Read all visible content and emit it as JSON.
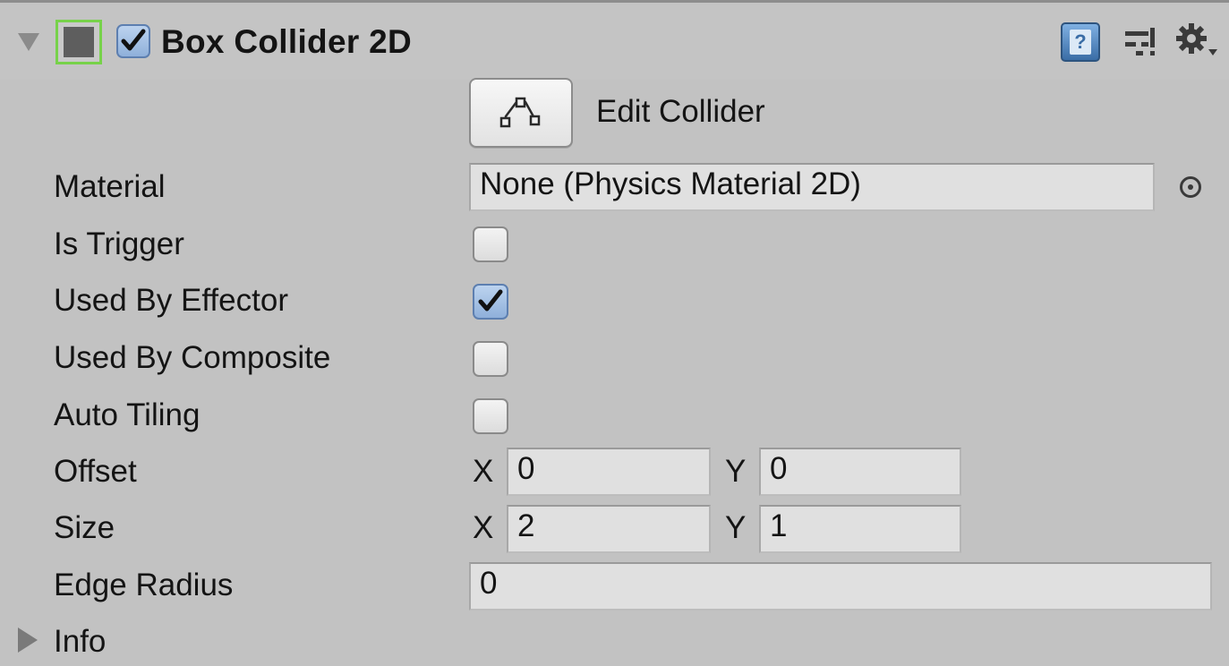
{
  "component": {
    "title": "Box Collider 2D",
    "enabled": true
  },
  "edit_collider": {
    "label": "Edit Collider"
  },
  "fields": {
    "material": {
      "label": "Material",
      "value": "None (Physics Material 2D)"
    },
    "is_trigger": {
      "label": "Is Trigger",
      "checked": false
    },
    "used_by_effector": {
      "label": "Used By Effector",
      "checked": true
    },
    "used_by_composite": {
      "label": "Used By Composite",
      "checked": false
    },
    "auto_tiling": {
      "label": "Auto Tiling",
      "checked": false
    },
    "offset": {
      "label": "Offset",
      "x_label": "X",
      "x": "0",
      "y_label": "Y",
      "y": "0"
    },
    "size": {
      "label": "Size",
      "x_label": "X",
      "x": "2",
      "y_label": "Y",
      "y": "1"
    },
    "edge_radius": {
      "label": "Edge Radius",
      "value": "0"
    }
  },
  "info": {
    "label": "Info"
  },
  "icons": {
    "foldout": "triangle-down-icon",
    "component": "box-collider-icon",
    "help": "help-book-icon",
    "presets": "presets-sliders-icon",
    "settings": "gear-dropdown-icon",
    "edit_shape": "edit-polygon-icon",
    "object_picker": "object-picker-icon",
    "info_foldout": "triangle-right-icon"
  },
  "colors": {
    "panel_bg": "#c2c2c2",
    "field_bg": "#e0e0e0",
    "check_accent": "#8fb0da",
    "component_icon_border": "#77d24a"
  }
}
